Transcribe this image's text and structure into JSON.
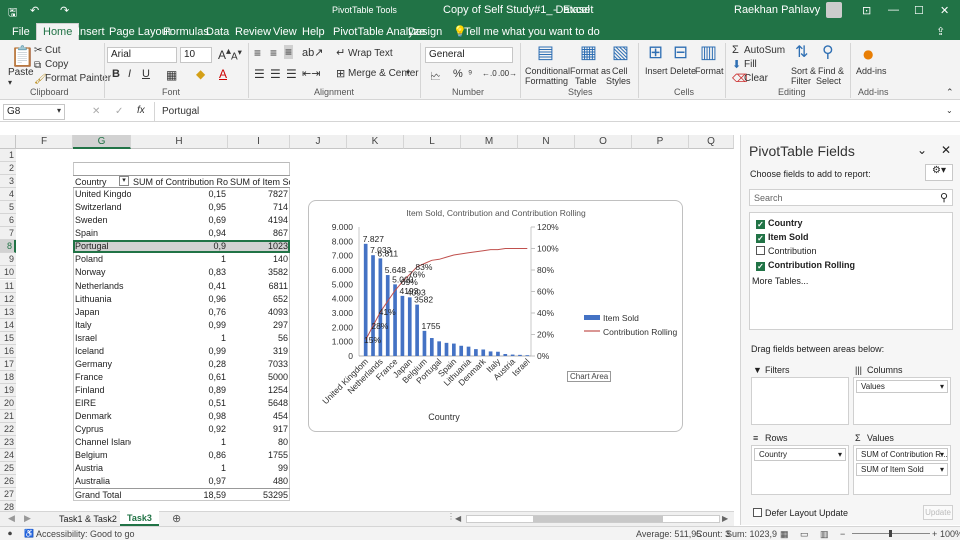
{
  "title": {
    "pivot_tools": "PivotTable Tools",
    "filename": "Copy of Self Study#1_ Dataset",
    "app": "Excel",
    "user": "Raekhan Pahlavy"
  },
  "tabs": [
    "File",
    "Home",
    "Insert",
    "Page Layout",
    "Formulas",
    "Data",
    "Review",
    "View",
    "Help",
    "PivotTable Analyze",
    "Design"
  ],
  "tell_me": "Tell me what you want to do",
  "ribbon": {
    "paste": "Paste",
    "cut": "Cut",
    "copy": "Copy",
    "format_painter": "Format Painter",
    "clipboard": "Clipboard",
    "font_name": "Arial",
    "font_size": "10",
    "font": "Font",
    "wrap_text": "Wrap Text",
    "merge_center": "Merge & Center",
    "alignment": "Alignment",
    "number_format": "General",
    "number": "Number",
    "cond_fmt1": "Conditional",
    "cond_fmt2": "Formatting",
    "fmt_table1": "Format as",
    "fmt_table2": "Table",
    "cell_styles1": "Cell",
    "cell_styles2": "Styles",
    "styles": "Styles",
    "insert": "Insert",
    "delete": "Delete",
    "format": "Format",
    "cells": "Cells",
    "autosum": "AutoSum",
    "fill": "Fill",
    "clear": "Clear",
    "sort1": "Sort &",
    "sort2": "Filter",
    "find1": "Find &",
    "find2": "Select",
    "editing": "Editing",
    "addins": "Add-ins",
    "addins_group": "Add-ins"
  },
  "formula_bar": {
    "name_box": "G8",
    "formula": "Portugal",
    "fx": "fx"
  },
  "columns": [
    "F",
    "G",
    "H",
    "I",
    "J",
    "K",
    "L",
    "M",
    "N",
    "O",
    "P",
    "Q"
  ],
  "rows": [
    "1",
    "2",
    "3",
    "4",
    "5",
    "6",
    "7",
    "8",
    "9",
    "10",
    "11",
    "12",
    "13",
    "14",
    "15",
    "16",
    "17",
    "18",
    "19",
    "20",
    "21",
    "22",
    "23",
    "24",
    "25",
    "26",
    "27",
    "28"
  ],
  "table": {
    "headers": [
      "Country",
      "SUM of Contribution Rolling",
      "SUM of Item Sold"
    ],
    "rows": [
      [
        "United Kingdom",
        "0,15",
        "7827"
      ],
      [
        "Switzerland",
        "0,95",
        "714"
      ],
      [
        "Sweden",
        "0,69",
        "4194"
      ],
      [
        "Spain",
        "0,94",
        "867"
      ],
      [
        "Portugal",
        "0,9",
        "1023"
      ],
      [
        "Poland",
        "1",
        "140"
      ],
      [
        "Norway",
        "0,83",
        "3582"
      ],
      [
        "Netherlands",
        "0,41",
        "6811"
      ],
      [
        "Lithuania",
        "0,96",
        "652"
      ],
      [
        "Japan",
        "0,76",
        "4093"
      ],
      [
        "Italy",
        "0,99",
        "297"
      ],
      [
        "Israel",
        "1",
        "56"
      ],
      [
        "Iceland",
        "0,99",
        "319"
      ],
      [
        "Germany",
        "0,28",
        "7033"
      ],
      [
        "France",
        "0,61",
        "5000"
      ],
      [
        "Finland",
        "0,89",
        "1254"
      ],
      [
        "EIRE",
        "0,51",
        "5648"
      ],
      [
        "Denmark",
        "0,98",
        "454"
      ],
      [
        "Cyprus",
        "0,92",
        "917"
      ],
      [
        "Channel Islands",
        "1",
        "80"
      ],
      [
        "Belgium",
        "0,86",
        "1755"
      ],
      [
        "Austria",
        "1",
        "99"
      ],
      [
        "Australia",
        "0,97",
        "480"
      ]
    ],
    "total": [
      "Grand Total",
      "18,59",
      "53295"
    ]
  },
  "chart_data": {
    "type": "bar",
    "title": "Item Sold, Contribution and Contribution Rolling",
    "xlabel": "Country",
    "categories": [
      "United Kingdom",
      "Germany",
      "Netherlands",
      "EIRE",
      "France",
      "Sweden",
      "Japan",
      "Norway",
      "Belgium",
      "Finland",
      "Portugal",
      "Cyprus",
      "Spain",
      "Switzerland",
      "Lithuania",
      "Australia",
      "Denmark",
      "Iceland",
      "Italy",
      "Poland",
      "Austria",
      "Channel Islands",
      "Israel"
    ],
    "shown_x_labels": [
      "United Kingdom",
      "Netherlands",
      "France",
      "Japan",
      "Belgium",
      "Portugal",
      "Spain",
      "Lithuania",
      "Denmark",
      "Italy",
      "Austria",
      "Israel"
    ],
    "series": [
      {
        "name": "Item Sold",
        "values": [
          7827,
          7033,
          6811,
          5648,
          5000,
          4194,
          4093,
          3582,
          1755,
          1254,
          1023,
          917,
          867,
          714,
          652,
          480,
          454,
          319,
          297,
          140,
          99,
          80,
          56
        ],
        "color": "#4472c4"
      },
      {
        "name": "Contribution Rolling",
        "values": [
          0.15,
          0.28,
          0.41,
          0.51,
          0.61,
          0.69,
          0.76,
          0.83,
          0.86,
          0.89,
          0.9,
          0.92,
          0.94,
          0.95,
          0.96,
          0.97,
          0.98,
          0.99,
          0.99,
          1,
          1,
          1,
          1
        ],
        "color": "#c0504d",
        "axis": "secondary"
      }
    ],
    "data_labels": [
      "7.827",
      "7.033",
      "6.811",
      "5.648",
      "5.000",
      "4193",
      "4093",
      "3582",
      "1755",
      "15%",
      "28%",
      "41%",
      "69%",
      "76%",
      "83%"
    ],
    "y_ticks": [
      "0",
      "1.000",
      "2.000",
      "3.000",
      "4.000",
      "5.000",
      "6.000",
      "7.000",
      "8.000",
      "9.000"
    ],
    "y2_ticks": [
      "0%",
      "20%",
      "40%",
      "60%",
      "80%",
      "100%",
      "120%"
    ],
    "ylim": [
      0,
      9000
    ],
    "y2lim": [
      0,
      1.2
    ],
    "legend": "right",
    "chart_area_tooltip": "Chart Area"
  },
  "panel": {
    "title": "PivotTable Fields",
    "subtitle": "Choose fields to add to report:",
    "search_placeholder": "Search",
    "fields": [
      {
        "label": "Country",
        "checked": true
      },
      {
        "label": "Item Sold",
        "checked": true
      },
      {
        "label": "Contribution",
        "checked": false
      },
      {
        "label": "Contribution Rolling",
        "checked": true
      }
    ],
    "more_tables": "More Tables...",
    "drag_hint": "Drag fields between areas below:",
    "filters": "Filters",
    "columns": "Columns",
    "columns_item": "Values",
    "rows": "Rows",
    "rows_item": "Country",
    "values": "Values",
    "values_items": [
      "SUM of Contribution R...",
      "SUM of Item Sold"
    ],
    "defer": "Defer Layout Update",
    "update": "Update"
  },
  "sheets": [
    "Task1 & Task2",
    "Task3"
  ],
  "status": {
    "accessibility": "Accessibility: Good to go",
    "average": "Average: 511,95",
    "count": "Count: 3",
    "sum": "Sum: 1023,9",
    "zoom": "100%"
  }
}
